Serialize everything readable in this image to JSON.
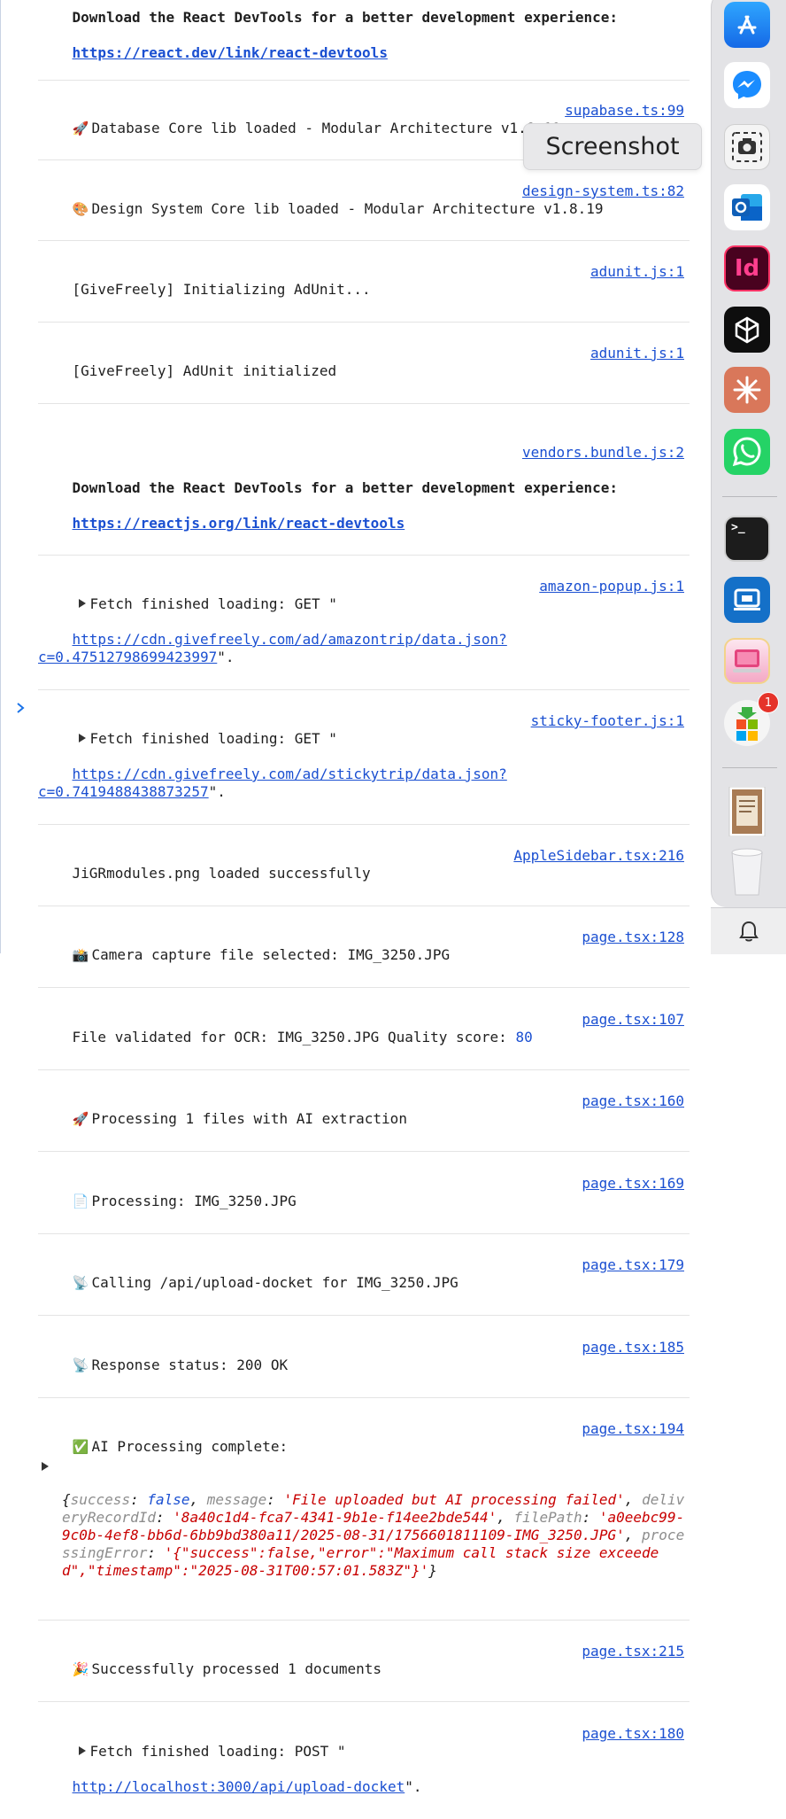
{
  "console": {
    "rows": {
      "r0": {
        "line1": "Download the React DevTools for a better development experience:",
        "link": "https://react.dev/link/react-devtools"
      },
      "r1": {
        "icon": "🚀",
        "text": "Database Core lib loaded - Modular Architecture v1.8.19",
        "src": "supabase.ts:99"
      },
      "r2": {
        "icon": "🎨",
        "text": "Design System Core lib loaded - Modular Architecture v1.8.19",
        "src": "design-system.ts:82"
      },
      "r3": {
        "text": "[GiveFreely] Initializing AdUnit...",
        "src": "adunit.js:1"
      },
      "r4": {
        "text": "[GiveFreely] AdUnit initialized",
        "src": "adunit.js:1"
      },
      "r5": {
        "src": "vendors.bundle.js:2",
        "line1": "Download the React DevTools for a better development experience:",
        "link": "https://reactjs.org/link/react-devtools"
      },
      "r6": {
        "text": "Fetch finished loading: GET \"",
        "src": "amazon-popup.js:1",
        "link": "https://cdn.givefreely.com/ad/amazontrip/data.json?c=0.47512798699423997",
        "tail": "\"."
      },
      "r7": {
        "text": "Fetch finished loading: GET \"",
        "src": "sticky-footer.js:1",
        "link": "https://cdn.givefreely.com/ad/stickytrip/data.json?c=0.7419488438873257",
        "tail": "\"."
      },
      "r8": {
        "text": "JiGRmodules.png loaded successfully",
        "src": "AppleSidebar.tsx:216"
      },
      "r9": {
        "icon": "📸",
        "text": "Camera capture file selected: IMG_3250.JPG",
        "src": "page.tsx:128"
      },
      "r10": {
        "text": "File validated for OCR: IMG_3250.JPG Quality score: ",
        "score": "80",
        "src": "page.tsx:107"
      },
      "r11": {
        "icon": "🚀",
        "text": "Processing 1 files with AI extraction",
        "src": "page.tsx:160"
      },
      "r12": {
        "icon": "📄",
        "text": "Processing: IMG_3250.JPG",
        "src": "page.tsx:169"
      },
      "r13": {
        "icon": "📡",
        "text": "Calling /api/upload-docket for IMG_3250.JPG",
        "src": "page.tsx:179"
      },
      "r14": {
        "icon": "📡",
        "text": "Response status: 200 OK",
        "src": "page.tsx:185"
      },
      "r15": {
        "icon": "✅",
        "text": "AI Processing complete:",
        "src": "page.tsx:194",
        "obj": {
          "k_success": "success",
          "v_success": "false",
          "k_message": "message",
          "v_message": "'File uploaded but AI processing failed'",
          "k_del": "deliveryRecordId",
          "v_del": "'8a40c1d4-fca7-4341-9b1e-f14ee2bde544'",
          "k_file": "filePath",
          "v_file": "'a0eebc99-9c0b-4ef8-bb6d-6bb9bd380a11/2025-08-31/1756601811109-IMG_3250.JPG'",
          "k_err": "processingError",
          "v_err": "'{\"success\":false,\"error\":\"Maximum call stack size exceeded\",\"timestamp\":\"2025-08-31T00:57:01.583Z\"}'"
        }
      },
      "r16": {
        "icon": "🎉",
        "text": "Successfully processed 1 documents",
        "src": "page.tsx:215"
      },
      "r17": {
        "text": "Fetch finished loading: POST \"",
        "src": "page.tsx:180",
        "link": "http://localhost:3000/api/upload-docket",
        "tail": "\"."
      }
    }
  },
  "tooltip": {
    "label": "Screenshot"
  },
  "dock": {
    "icons": [
      "app-store-icon",
      "messenger-icon",
      "screenshot-icon",
      "outlook-icon",
      "indesign-icon",
      "perplexity-icon",
      "claude-icon",
      "whatsapp-icon",
      "terminal-icon",
      "remote-desktop-icon",
      "cleanmymac-icon",
      "microsoft-installer-icon",
      "document-thumbnail-icon",
      "trash-icon",
      "bell-icon"
    ],
    "indesign_label": "Id",
    "terminal_label": ">_",
    "badge_count": "1",
    "colors": {
      "app_store": "#1c7cf2",
      "messenger": "#1877f2",
      "outlook": "#0a64c8",
      "indesign": "#49021f",
      "whatsapp": "#25d366",
      "claude": "#d9775a",
      "remote": "#1470c8"
    }
  }
}
